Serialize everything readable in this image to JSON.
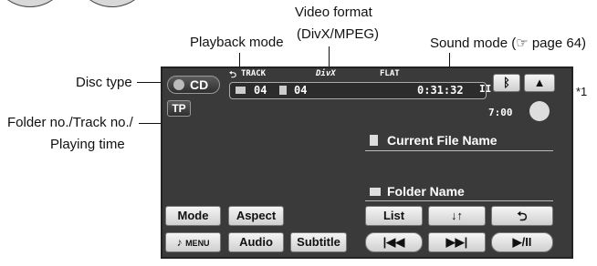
{
  "callouts": {
    "video_format_line1": "Video format",
    "video_format_line2": "(DivX/MPEG)",
    "playback_mode": "Playback mode",
    "sound_mode": "Sound mode (☞ page 64)",
    "disc_type": "Disc type",
    "folder_line1": "Folder no./Track no./",
    "folder_line2": "Playing time",
    "note_marker": "*1"
  },
  "screen": {
    "disc_type": "CD",
    "playback_mode_indicator": "TRACK",
    "video_format_indicator": "DivX",
    "sound_mode_indicator": "FLAT",
    "folder_no": "04",
    "track_no": "04",
    "playing_time": "0:31:32",
    "clock": "7:00",
    "current_file_name": "Current File Name",
    "folder_name": "Folder Name",
    "tp_label": "TP",
    "pause_indicator": "II"
  },
  "buttons": {
    "mode": "Mode",
    "aspect": "Aspect",
    "menu": "MENU",
    "audio": "Audio",
    "subtitle": "Subtitle",
    "list": "List",
    "folder_down_up": "↓↑",
    "repeat": "⮌",
    "prev": "|◀◀",
    "next": "▶▶|",
    "play_pause": "▶/II",
    "eject": "▲",
    "bluetooth": "ᛒ"
  },
  "icons": [
    "disc-icon",
    "repeat-icon",
    "file-icon",
    "folder-icon",
    "bluetooth-icon",
    "eject-icon",
    "note-icon",
    "adjust-arrows-icon"
  ]
}
